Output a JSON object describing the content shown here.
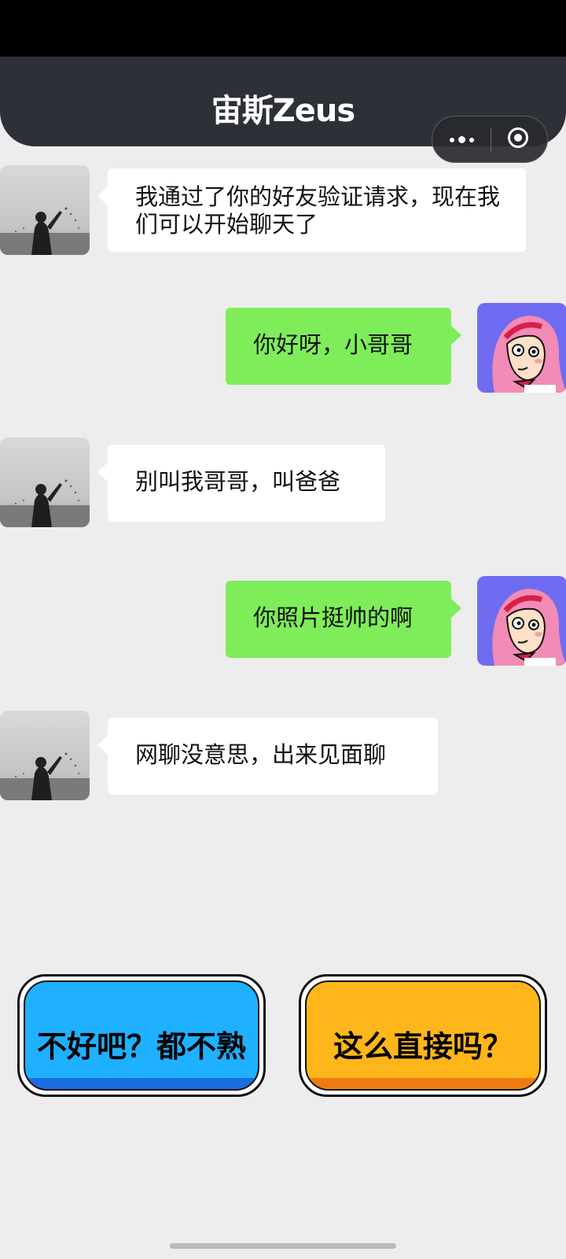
{
  "header": {
    "title": "宙斯Zeus"
  },
  "colors": {
    "header_bg": "#2e3038",
    "incoming_bubble": "#ffffff",
    "outgoing_bubble": "#7fed5a",
    "choice_left": "#1fb0ff",
    "choice_right": "#ffb61a"
  },
  "messages": [
    {
      "from": "contact",
      "text": "我通过了你的好友验证请求，现在我们可以开始聊天了"
    },
    {
      "from": "me",
      "text": "你好呀，小哥哥"
    },
    {
      "from": "contact",
      "text": "别叫我哥哥，叫爸爸"
    },
    {
      "from": "me",
      "text": "你照片挺帅的啊"
    },
    {
      "from": "contact",
      "text": "网聊没意思，出来见面聊"
    }
  ],
  "choices": [
    {
      "label": "不好吧？都不熟"
    },
    {
      "label": "这么直接吗？"
    }
  ],
  "icons": {
    "capsule_more": "more-dots-icon",
    "capsule_close": "target-close-icon"
  }
}
